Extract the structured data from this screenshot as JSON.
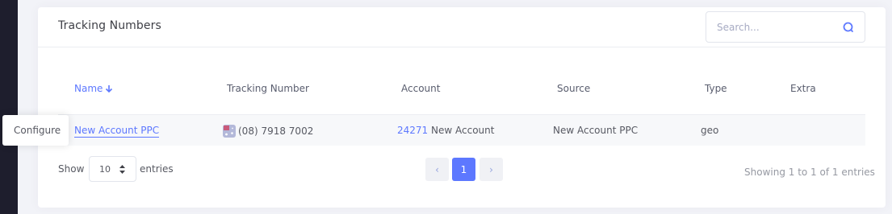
{
  "card": {
    "title": "Tracking Numbers",
    "search": {
      "placeholder": "Search...",
      "value": ""
    }
  },
  "table": {
    "columns": [
      {
        "label": "Name",
        "sorted": "descending"
      },
      {
        "label": "Tracking Number"
      },
      {
        "label": "Account"
      },
      {
        "label": "Source"
      },
      {
        "label": "Type"
      },
      {
        "label": "Extra"
      }
    ],
    "rows": [
      {
        "name": "New Account PPC",
        "tracking_number": "(08) 7918 7002",
        "tracking_flag": "australia-flag-icon",
        "account_id": "24271",
        "account_name": "New Account",
        "source": "New Account PPC",
        "type": "geo",
        "extra": ""
      }
    ]
  },
  "tooltip": {
    "text": "Configure"
  },
  "footer": {
    "show_label": "Show",
    "page_size": "10",
    "entries_label": "entries",
    "pagination": {
      "prev": "‹",
      "current": "1",
      "next": "›"
    },
    "summary": "Showing 1 to 1 of 1 entries"
  },
  "colors": {
    "accent": "#5d78ff",
    "sidebar": "#1e1e2d",
    "background": "#f2f3f8"
  }
}
